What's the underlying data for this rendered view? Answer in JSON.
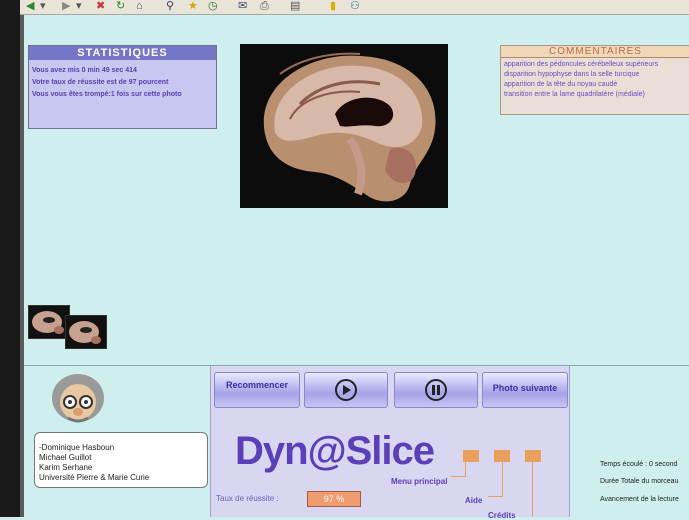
{
  "toolbar": {
    "items": [
      "back-icon",
      "forward-icon",
      "stop-icon",
      "refresh-icon",
      "home-icon",
      "search-icon",
      "favorites-icon",
      "history-icon",
      "mail-icon",
      "print-icon",
      "edit-icon",
      "folder-icon",
      "messenger-icon"
    ]
  },
  "stats": {
    "title": "STATISTIQUES",
    "lines": [
      "Vous avez mis 0 min 49 sec 414",
      "Votre taux de réussite est de 97 pourcent",
      "Vous vous êtes trompé:1 fois sur cette photo"
    ]
  },
  "comments": {
    "title": "COMMENTAIRES",
    "lines": [
      "apparition des pédoncules cérébelleux supérieurs",
      "disparition hypophyse dans la selle turcique",
      "apparition de la tête du noyau caudé",
      " transition entre la lame quadrilatère (médiale)"
    ]
  },
  "controls": {
    "restart": "Recommencer",
    "next_photo": "Photo suivante",
    "logo": "Dyn@Slice",
    "menu": "Menu principal",
    "help": "Aide",
    "credits_link": "Crédits",
    "rate_label": "Taux de réussite :",
    "rate_value": "97 %"
  },
  "credits": {
    "lines": [
      "-Dominique Hasboun",
      "Michael Guillot",
      "Karim Serhane",
      "Université Pierre & Marie Curie"
    ]
  },
  "right_info": {
    "lines": [
      "Temps écoulé : 0 second",
      "Durée Totale du morceau",
      "Avancement de la lecture"
    ]
  }
}
